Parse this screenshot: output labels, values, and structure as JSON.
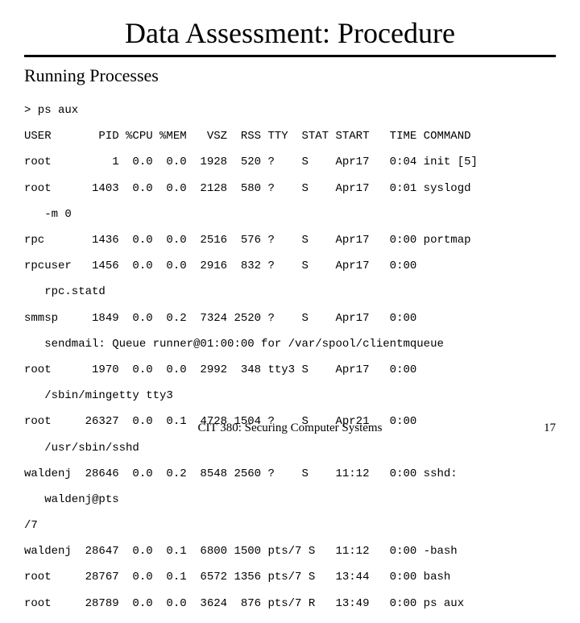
{
  "title": "Data Assessment: Procedure",
  "subtitle": "Running Processes",
  "prompt": "> ps aux",
  "header_line": "USER       PID %CPU %MEM   VSZ  RSS TTY  STAT START   TIME COMMAND",
  "lines": [
    "root         1  0.0  0.0  1928  520 ?    S    Apr17   0:04 init [5]",
    "root      1403  0.0  0.0  2128  580 ?    S    Apr17   0:01 syslogd",
    "   -m 0",
    "rpc       1436  0.0  0.0  2516  576 ?    S    Apr17   0:00 portmap",
    "rpcuser   1456  0.0  0.0  2916  832 ?    S    Apr17   0:00",
    "   rpc.statd",
    "smmsp     1849  0.0  0.2  7324 2520 ?    S    Apr17   0:00",
    "   sendmail: Queue runner@01:00:00 for /var/spool/clientmqueue",
    "root      1970  0.0  0.0  2992  348 tty3 S    Apr17   0:00",
    "   /sbin/mingetty tty3",
    "root     26327  0.0  0.1  4728 1504 ?    S    Apr21   0:00",
    "   /usr/sbin/sshd",
    "waldenj  28646  0.0  0.2  8548 2560 ?    S    11:12   0:00 sshd:",
    "   waldenj@pts",
    "/7",
    "waldenj  28647  0.0  0.1  6800 1500 pts/7 S   11:12   0:00 -bash",
    "root     28767  0.0  0.1  6572 1356 pts/7 S   13:44   0:00 bash",
    "root     28789  0.0  0.0  3624  876 pts/7 R   13:49   0:00 ps aux"
  ],
  "footer": "CIT 380: Securing Computer Systems",
  "page_number": "17"
}
